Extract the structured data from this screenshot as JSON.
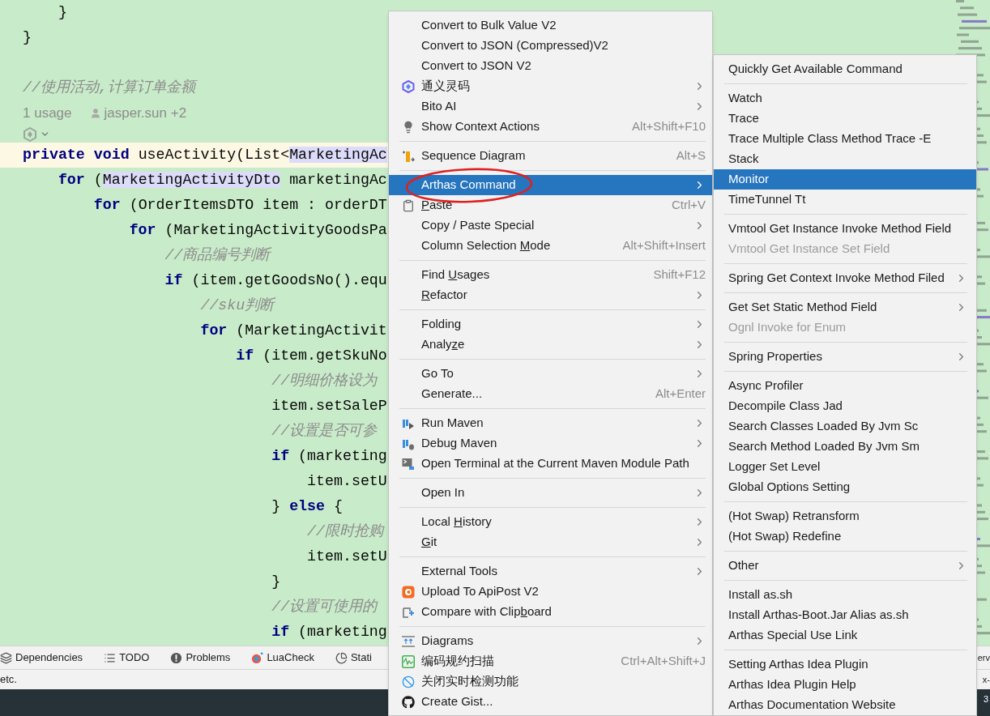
{
  "editor": {
    "lines": [
      {
        "kind": "code",
        "current": false,
        "tokens": [
          {
            "kind": "plain",
            "text": "    }"
          }
        ]
      },
      {
        "kind": "code",
        "current": false,
        "tokens": [
          {
            "kind": "plain",
            "text": "}"
          }
        ]
      },
      {
        "kind": "blank"
      },
      {
        "kind": "code",
        "current": false,
        "tokens": [
          {
            "kind": "comment",
            "text": "//使用活动,计算订单金额"
          }
        ]
      },
      {
        "kind": "inlay",
        "usages": "1 usage",
        "author": "jasper.sun +2"
      },
      {
        "kind": "ai_hint"
      },
      {
        "kind": "code",
        "current": true,
        "tokens": [
          {
            "kind": "keyword",
            "text": "private"
          },
          {
            "kind": "keyword",
            "text": " void"
          },
          {
            "kind": "plain",
            "text": " useActivity(List<"
          },
          {
            "kind": "type",
            "text": "MarketingAc"
          }
        ]
      },
      {
        "kind": "code",
        "current": false,
        "tokens": [
          {
            "kind": "keyword",
            "text": "    for"
          },
          {
            "kind": "plain",
            "text": " ("
          },
          {
            "kind": "type",
            "text": "MarketingActivityDto"
          },
          {
            "kind": "plain",
            "text": " marketingAc"
          }
        ]
      },
      {
        "kind": "code",
        "current": false,
        "tokens": [
          {
            "kind": "keyword",
            "text": "        for"
          },
          {
            "kind": "plain",
            "text": " (OrderItemsDTO item : orderDT"
          }
        ]
      },
      {
        "kind": "code",
        "current": false,
        "tokens": [
          {
            "kind": "keyword",
            "text": "            for"
          },
          {
            "kind": "plain",
            "text": " (MarketingActivityGoodsPa"
          }
        ]
      },
      {
        "kind": "code",
        "current": false,
        "tokens": [
          {
            "kind": "comment",
            "text": "                //商品编号判断"
          }
        ]
      },
      {
        "kind": "code",
        "current": false,
        "tokens": [
          {
            "kind": "keyword",
            "text": "                if"
          },
          {
            "kind": "plain",
            "text": " (item.getGoodsNo().equ"
          }
        ]
      },
      {
        "kind": "code",
        "current": false,
        "tokens": [
          {
            "kind": "comment",
            "text": "                    //sku判断"
          }
        ]
      },
      {
        "kind": "code",
        "current": false,
        "tokens": [
          {
            "kind": "keyword",
            "text": "                    for"
          },
          {
            "kind": "plain",
            "text": " (MarketingActivit"
          }
        ]
      },
      {
        "kind": "code",
        "current": false,
        "tokens": [
          {
            "kind": "keyword",
            "text": "                        if"
          },
          {
            "kind": "plain",
            "text": " (item.getSkuNo"
          }
        ]
      },
      {
        "kind": "code",
        "current": false,
        "tokens": [
          {
            "kind": "comment",
            "text": "                            //明细价格设为"
          }
        ]
      },
      {
        "kind": "code",
        "current": false,
        "tokens": [
          {
            "kind": "plain",
            "text": "                            item.setSaleP"
          }
        ]
      },
      {
        "kind": "code",
        "current": false,
        "tokens": [
          {
            "kind": "comment",
            "text": "                            //设置是否可参"
          }
        ]
      },
      {
        "kind": "code",
        "current": false,
        "tokens": [
          {
            "kind": "keyword",
            "text": "                            if"
          },
          {
            "kind": "plain",
            "text": " (marketing"
          }
        ]
      },
      {
        "kind": "code",
        "current": false,
        "tokens": [
          {
            "kind": "plain",
            "text": "                                item.setU"
          }
        ]
      },
      {
        "kind": "code",
        "current": false,
        "tokens": [
          {
            "kind": "plain",
            "text": "                            }"
          },
          {
            "kind": "keyword",
            "text": " else"
          },
          {
            "kind": "plain",
            "text": " {"
          }
        ]
      },
      {
        "kind": "code",
        "current": false,
        "tokens": [
          {
            "kind": "comment",
            "text": "                                //限时抢购"
          }
        ]
      },
      {
        "kind": "code",
        "current": false,
        "tokens": [
          {
            "kind": "plain",
            "text": "                                item.setU"
          }
        ]
      },
      {
        "kind": "code",
        "current": false,
        "tokens": [
          {
            "kind": "plain",
            "text": "                            }"
          }
        ]
      },
      {
        "kind": "code",
        "current": false,
        "tokens": [
          {
            "kind": "comment",
            "text": "                            //设置可使用的"
          }
        ]
      },
      {
        "kind": "code",
        "current": false,
        "tokens": [
          {
            "kind": "keyword",
            "text": "                            if"
          },
          {
            "kind": "plain",
            "text": " (marketing"
          }
        ]
      }
    ]
  },
  "tool_window_bar": {
    "tabs": [
      {
        "label": "Dependencies"
      },
      {
        "label": "TODO"
      },
      {
        "label": "Problems"
      },
      {
        "label": "LuaCheck"
      },
      {
        "label": "Stati"
      }
    ],
    "right_fragment": "erv"
  },
  "status_bar": {
    "text": "etc.",
    "right_fragment": "x-"
  },
  "taskbar": {
    "right_fragment": "3"
  },
  "context_menu": {
    "items": [
      {
        "kind": "item",
        "label": "Convert to Bulk Value V2",
        "selected": false
      },
      {
        "kind": "item",
        "label": "Convert to JSON (Compressed)V2",
        "selected": false
      },
      {
        "kind": "item",
        "label": "Convert to JSON V2",
        "selected": false
      },
      {
        "kind": "item",
        "label": "通义灵码",
        "submenu": true,
        "selected": false
      },
      {
        "kind": "item",
        "label": "Bito AI",
        "submenu": true,
        "selected": false
      },
      {
        "kind": "item",
        "label": "Show Context Actions",
        "shortcut": "Alt+Shift+F10",
        "selected": false
      },
      {
        "kind": "separator"
      },
      {
        "kind": "item",
        "label": "Sequence Diagram",
        "shortcut": "Alt+S",
        "selected": false
      },
      {
        "kind": "separator"
      },
      {
        "kind": "item",
        "label": "Arthas Command",
        "submenu": true,
        "selected": true
      },
      {
        "kind": "item",
        "label_parts": {
          "mnemonic": "P",
          "after": "aste"
        },
        "shortcut": "Ctrl+V",
        "selected": false
      },
      {
        "kind": "item",
        "label": "Copy / Paste Special",
        "submenu": true,
        "selected": false
      },
      {
        "kind": "item",
        "label_parts": {
          "before": "Column Selection ",
          "mnemonic": "M",
          "after": "ode"
        },
        "shortcut": "Alt+Shift+Insert",
        "selected": false
      },
      {
        "kind": "separator"
      },
      {
        "kind": "item",
        "label_parts": {
          "before": "Find ",
          "mnemonic": "U",
          "after": "sages"
        },
        "shortcut": "Shift+F12",
        "selected": false
      },
      {
        "kind": "item",
        "label_parts": {
          "mnemonic": "R",
          "after": "efactor"
        },
        "submenu": true,
        "selected": false
      },
      {
        "kind": "separator"
      },
      {
        "kind": "item",
        "label": "Folding",
        "submenu": true,
        "selected": false
      },
      {
        "kind": "item",
        "label_parts": {
          "before": "Analy",
          "mnemonic": "z",
          "after": "e"
        },
        "submenu": true,
        "selected": false
      },
      {
        "kind": "separator"
      },
      {
        "kind": "item",
        "label": "Go To",
        "submenu": true,
        "selected": false
      },
      {
        "kind": "item",
        "label": "Generate...",
        "shortcut": "Alt+Enter",
        "selected": false
      },
      {
        "kind": "separator"
      },
      {
        "kind": "item",
        "label": "Run Maven",
        "submenu": true,
        "selected": false
      },
      {
        "kind": "item",
        "label": "Debug Maven",
        "submenu": true,
        "selected": false
      },
      {
        "kind": "item",
        "label": "Open Terminal at the Current Maven Module Path",
        "selected": false
      },
      {
        "kind": "separator"
      },
      {
        "kind": "item",
        "label": "Open In",
        "submenu": true,
        "selected": false
      },
      {
        "kind": "separator"
      },
      {
        "kind": "item",
        "label_parts": {
          "before": "Local ",
          "mnemonic": "H",
          "after": "istory"
        },
        "submenu": true,
        "selected": false
      },
      {
        "kind": "item",
        "label_parts": {
          "mnemonic": "G",
          "after": "it"
        },
        "submenu": true,
        "selected": false
      },
      {
        "kind": "separator"
      },
      {
        "kind": "item",
        "label": "External Tools",
        "submenu": true,
        "selected": false
      },
      {
        "kind": "item",
        "label": "Upload To ApiPost V2",
        "selected": false
      },
      {
        "kind": "item",
        "label_parts": {
          "before": "Compare with Clip",
          "mnemonic": "b",
          "after": "oard"
        },
        "selected": false
      },
      {
        "kind": "separator"
      },
      {
        "kind": "item",
        "label": "Diagrams",
        "submenu": true,
        "selected": false
      },
      {
        "kind": "item",
        "label": "编码规约扫描",
        "shortcut": "Ctrl+Alt+Shift+J",
        "selected": false
      },
      {
        "kind": "item",
        "label": "关闭实时检测功能",
        "selected": false
      },
      {
        "kind": "item",
        "label": "Create Gist...",
        "selected": false
      }
    ]
  },
  "submenu": {
    "items": [
      {
        "kind": "item",
        "label": "Quickly Get Available Command",
        "selected": false,
        "disabled": false
      },
      {
        "kind": "separator"
      },
      {
        "kind": "item",
        "label": "Watch",
        "selected": false,
        "disabled": false
      },
      {
        "kind": "item",
        "label": "Trace",
        "selected": false,
        "disabled": false
      },
      {
        "kind": "item",
        "label": "Trace Multiple Class Method Trace -E",
        "selected": false,
        "disabled": false
      },
      {
        "kind": "item",
        "label": "Stack",
        "selected": false,
        "disabled": false
      },
      {
        "kind": "item",
        "label": "Monitor",
        "selected": true,
        "disabled": false
      },
      {
        "kind": "item",
        "label": "TimeTunnel Tt",
        "selected": false,
        "disabled": false
      },
      {
        "kind": "separator"
      },
      {
        "kind": "item",
        "label": "Vmtool Get Instance Invoke Method Field",
        "selected": false,
        "disabled": false
      },
      {
        "kind": "item",
        "label": "Vmtool Get Instance Set Field",
        "selected": false,
        "disabled": true
      },
      {
        "kind": "separator"
      },
      {
        "kind": "item",
        "label": "Spring Get Context Invoke Method Filed",
        "submenu": true,
        "selected": false,
        "disabled": false
      },
      {
        "kind": "separator"
      },
      {
        "kind": "item",
        "label": "Get Set Static Method Field",
        "submenu": true,
        "selected": false,
        "disabled": false
      },
      {
        "kind": "item",
        "label": "Ognl Invoke for Enum",
        "selected": false,
        "disabled": true
      },
      {
        "kind": "separator"
      },
      {
        "kind": "item",
        "label": "Spring Properties",
        "submenu": true,
        "selected": false,
        "disabled": false
      },
      {
        "kind": "separator"
      },
      {
        "kind": "item",
        "label": "Async Profiler",
        "selected": false,
        "disabled": false
      },
      {
        "kind": "item",
        "label": "Decompile Class Jad",
        "selected": false,
        "disabled": false
      },
      {
        "kind": "item",
        "label": "Search Classes Loaded By Jvm Sc",
        "selected": false,
        "disabled": false
      },
      {
        "kind": "item",
        "label": "Search Method Loaded By Jvm Sm",
        "selected": false,
        "disabled": false
      },
      {
        "kind": "item",
        "label": "Logger Set Level",
        "selected": false,
        "disabled": false
      },
      {
        "kind": "item",
        "label": "Global Options Setting",
        "selected": false,
        "disabled": false
      },
      {
        "kind": "separator"
      },
      {
        "kind": "item",
        "label": "(Hot Swap) Retransform",
        "selected": false,
        "disabled": false
      },
      {
        "kind": "item",
        "label": "(Hot Swap) Redefine",
        "selected": false,
        "disabled": false
      },
      {
        "kind": "separator"
      },
      {
        "kind": "item",
        "label": "Other",
        "submenu": true,
        "selected": false,
        "disabled": false
      },
      {
        "kind": "separator"
      },
      {
        "kind": "item",
        "label": "Install as.sh",
        "selected": false,
        "disabled": false
      },
      {
        "kind": "item",
        "label": "Install Arthas-Boot.Jar Alias as.sh",
        "selected": false,
        "disabled": false
      },
      {
        "kind": "item",
        "label": "Arthas Special Use Link",
        "selected": false,
        "disabled": false
      },
      {
        "kind": "separator"
      },
      {
        "kind": "item",
        "label": "Setting Arthas Idea Plugin",
        "selected": false,
        "disabled": false
      },
      {
        "kind": "item",
        "label": "Arthas Idea Plugin Help",
        "selected": false,
        "disabled": false
      },
      {
        "kind": "item",
        "label": "Arthas Documentation Website",
        "selected": false,
        "disabled": false
      }
    ]
  }
}
